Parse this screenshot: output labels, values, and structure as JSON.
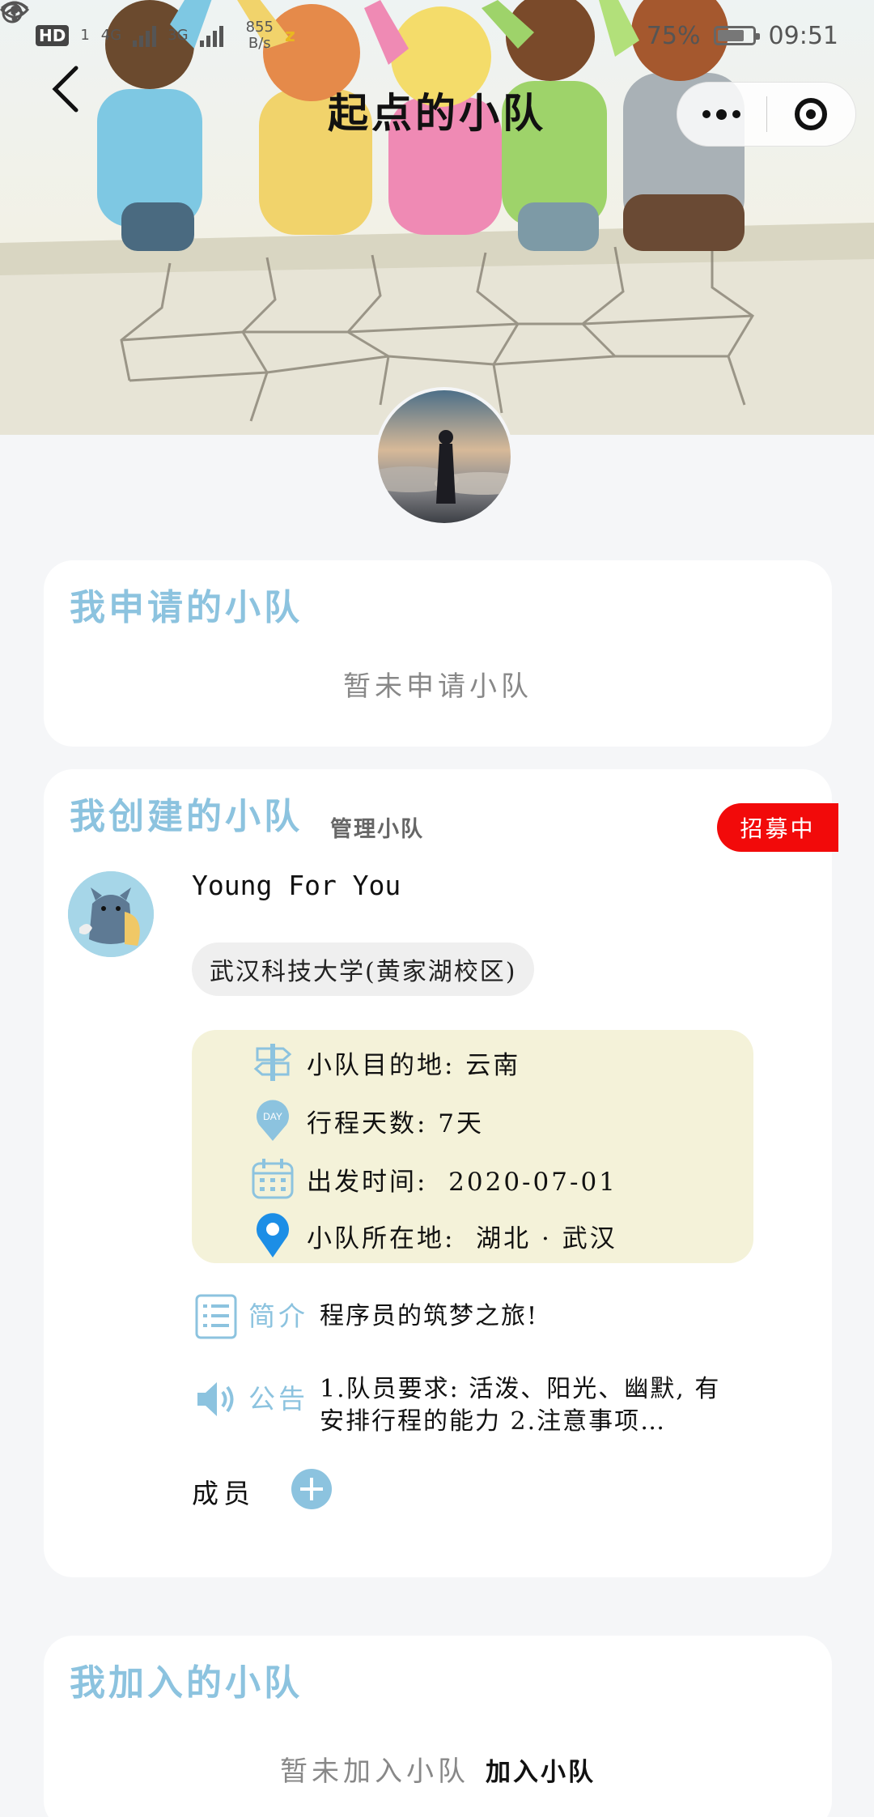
{
  "status_bar": {
    "hd": "HD",
    "sim": "1",
    "net1": "4G",
    "net2": "3G",
    "speed_value": "855",
    "speed_unit": "B/s",
    "battery": "75%",
    "time": "09:51"
  },
  "nav": {
    "title": "起点的小队"
  },
  "applied": {
    "title": "我申请的小队",
    "empty": "暂未申请小队"
  },
  "created": {
    "title": "我创建的小队",
    "manage": "管理小队",
    "badge": "招募中",
    "team_name": "Young For You",
    "school": "武汉科技大学(黄家湖校区)",
    "info": [
      {
        "icon": "signpost-icon",
        "text": "小队目的地: 云南"
      },
      {
        "icon": "day-pin-icon",
        "text": "行程天数: 7天"
      },
      {
        "icon": "calendar-icon",
        "text": "出发时间:  2020-07-01"
      },
      {
        "icon": "location-icon",
        "text": "小队所在地:  湖北 · 武汉"
      }
    ],
    "intro_key": "简介",
    "intro_val": "程序员的筑梦之旅!",
    "notice_key": "公告",
    "notice_val": "1.队员要求: 活泼、阳光、幽默, 有安排行程的能力 2.注意事项…",
    "members_label": "成员"
  },
  "joined": {
    "title": "我加入的小队",
    "empty": "暂未加入小队",
    "join_link": "加入小队"
  },
  "colors": {
    "accent_blue": "#8cc3df",
    "badge_red": "#f20a0a",
    "info_bg": "#f4f2d9"
  }
}
